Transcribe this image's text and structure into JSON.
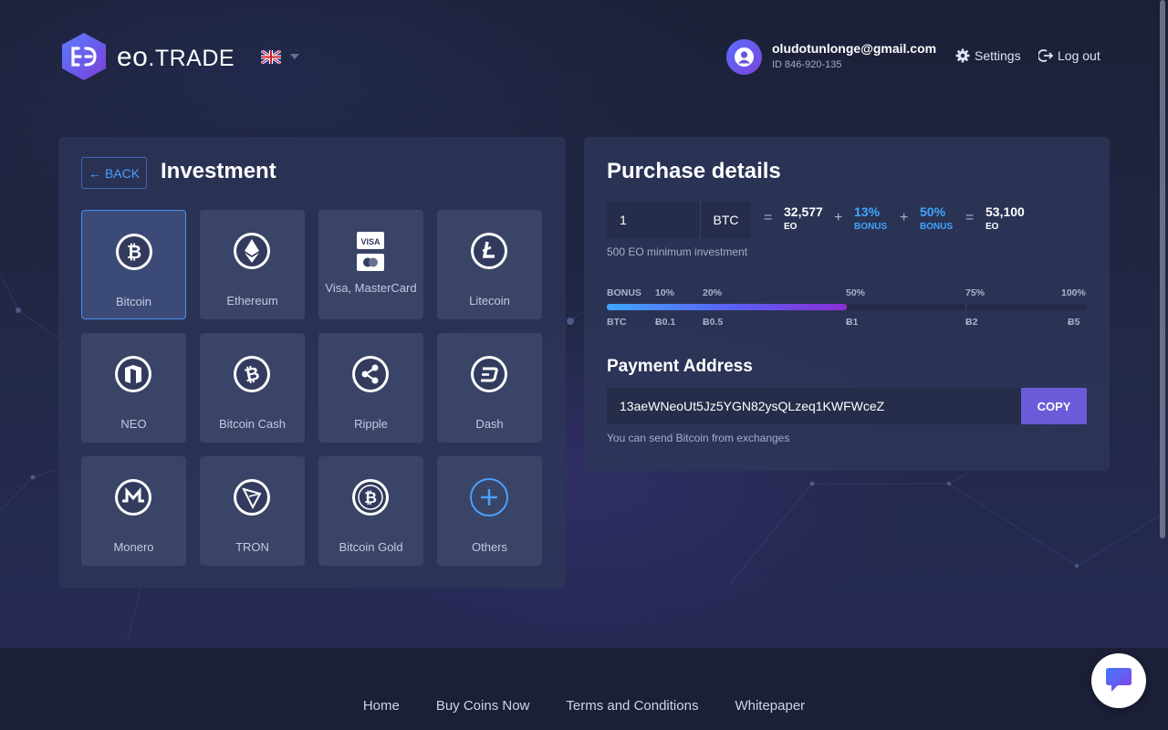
{
  "header": {
    "brand_eo": "eo",
    "brand_rest": ".TRADE",
    "user_email": "oludotunlonge@gmail.com",
    "user_id": "ID 846-920-135",
    "settings_label": "Settings",
    "logout_label": "Log out"
  },
  "investment": {
    "back_label": "BACK",
    "title": "Investment",
    "coins": [
      {
        "label": "Bitcoin",
        "icon": "bitcoin-icon",
        "selected": true
      },
      {
        "label": "Ethereum",
        "icon": "ethereum-icon"
      },
      {
        "label": "Visa, MasterCard",
        "icon": "card-icon",
        "card_text": "VISA"
      },
      {
        "label": "Litecoin",
        "icon": "litecoin-icon"
      },
      {
        "label": "NEO",
        "icon": "neo-icon"
      },
      {
        "label": "Bitcoin Cash",
        "icon": "bitcoin-cash-icon"
      },
      {
        "label": "Ripple",
        "icon": "ripple-icon"
      },
      {
        "label": "Dash",
        "icon": "dash-icon"
      },
      {
        "label": "Monero",
        "icon": "monero-icon"
      },
      {
        "label": "TRON",
        "icon": "tron-icon"
      },
      {
        "label": "Bitcoin Gold",
        "icon": "bitcoin-gold-icon"
      },
      {
        "label": "Others",
        "icon": "plus-icon"
      }
    ]
  },
  "purchase": {
    "title": "Purchase details",
    "amount": "1",
    "currency": "BTC",
    "eo_amount": "32,577",
    "eo_unit": "EO",
    "bonus_pct": "13%",
    "bonus_unit": "BONUS",
    "bonus_pct2": "50%",
    "bonus_unit2": "BONUS",
    "total": "53,100",
    "total_unit": "EO",
    "min_note": "500 EO minimum investment",
    "progress_fraction": 0.5,
    "bonus_tiers": [
      "BONUS",
      "10%",
      "20%",
      "50%",
      "75%",
      "100%"
    ],
    "btc_tiers": [
      "BTC",
      "Ƀ0.1",
      "Ƀ0.5",
      "Ƀ1",
      "Ƀ2",
      "Ƀ5"
    ],
    "payment_title": "Payment Address",
    "address": "13aeWNeoUt5Jz5YGN82ysQLzeq1KWFWceZ",
    "copy_label": "COPY",
    "address_note": "You can send Bitcoin from exchanges"
  },
  "footer": {
    "links": [
      "Home",
      "Buy Coins Now",
      "Terms and Conditions",
      "Whitepaper"
    ]
  },
  "colors": {
    "accent": "#3fa6ff",
    "copy_button": "#6c5bd8",
    "panel": "#2e375a",
    "background": "#1d2340"
  }
}
